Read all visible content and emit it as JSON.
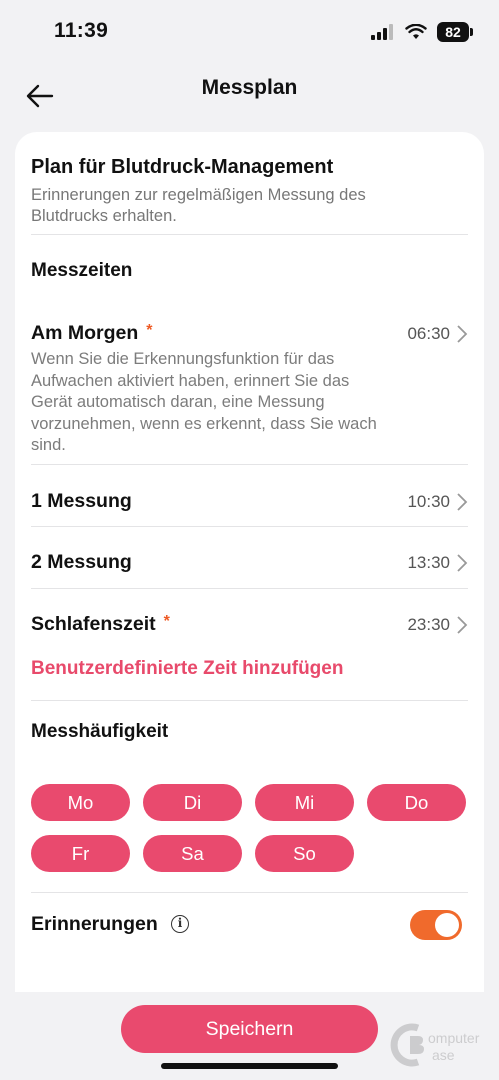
{
  "status_bar": {
    "time": "11:39",
    "battery": "82"
  },
  "nav": {
    "title": "Messplan"
  },
  "plan": {
    "title": "Plan für Blutdruck-Management",
    "description": "Erinnerungen zur regelmäßigen Messung des Blutdrucks erhalten."
  },
  "measure_times": {
    "title": "Messzeiten",
    "rows": [
      {
        "label": "Am Morgen",
        "required": "*",
        "time": "06:30",
        "description": "Wenn Sie die Erkennungsfunktion für das Aufwachen aktiviert haben, erinnert Sie das Gerät automatisch daran, eine Messung vorzunehmen, wenn es erkennt, dass Sie wach sind."
      },
      {
        "label": "1 Messung",
        "time": "10:30"
      },
      {
        "label": "2 Messung",
        "time": "13:30"
      },
      {
        "label": "Schlafenszeit",
        "required": "*",
        "time": "23:30"
      }
    ],
    "add_custom": "Benutzerdefinierte Zeit hinzufügen"
  },
  "frequency": {
    "title": "Messhäufigkeit",
    "days": [
      "Mo",
      "Di",
      "Mi",
      "Do",
      "Fr",
      "Sa",
      "So"
    ]
  },
  "reminders": {
    "label": "Erinnerungen",
    "info_icon": "info-icon",
    "enabled": true
  },
  "save_label": "Speichern",
  "watermark": "ComputerBase",
  "colors": {
    "accent": "#e94a6e",
    "toggle_on": "#f06a2c",
    "required_star": "#ee5a24"
  }
}
